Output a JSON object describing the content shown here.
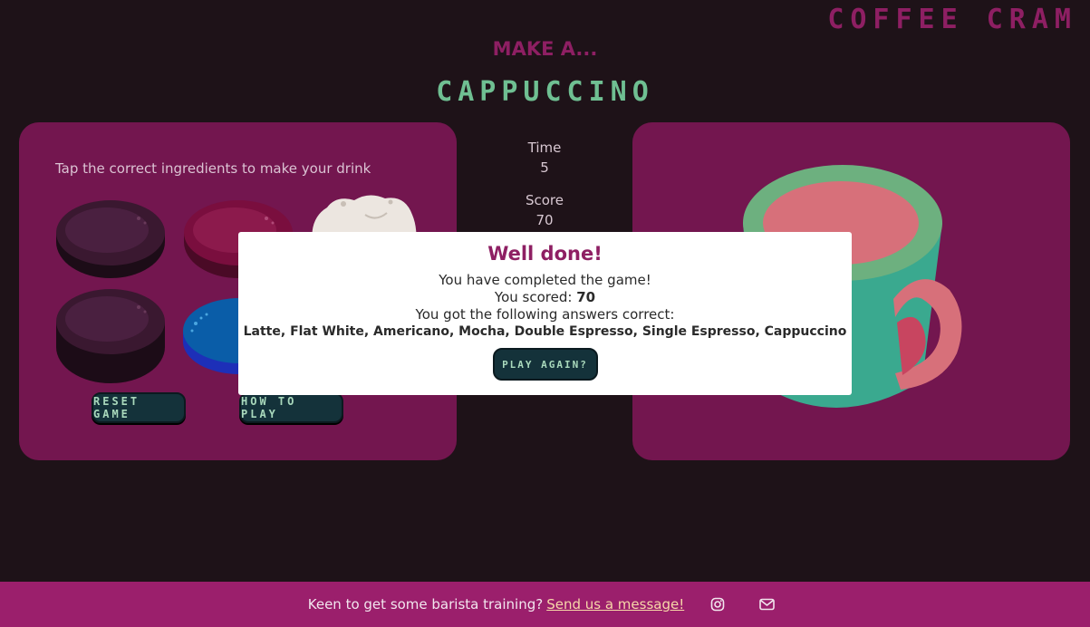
{
  "header": {
    "brand": "COFFEE CRAM",
    "prompt": "MAKE A...",
    "drink": "CAPPUCCINO"
  },
  "left_panel": {
    "instruction": "Tap the correct ingredients to make your drink",
    "reset_label": "RESET GAME",
    "how_label": "HOW TO PLAY"
  },
  "stats": {
    "time_label": "Time",
    "time_value": "5",
    "score_label": "Score",
    "score_value": "70"
  },
  "modal": {
    "title": "Well done!",
    "line1": "You have completed the game!",
    "score_prefix": "You scored: ",
    "score_value": "70",
    "line3": "You got the following answers correct:",
    "answers": "Latte, Flat White, Americano, Mocha, Double Espresso, Single Espresso, Cappuccino",
    "button": "PLAY AGAIN?"
  },
  "footer": {
    "text": "Keen to get some barista training?",
    "link": "Send us a message!",
    "icons": [
      "instagram-icon",
      "mail-icon"
    ]
  },
  "colors": {
    "background": "#1e1218",
    "panel": "#73164f",
    "accent": "#8e1f63",
    "drink_title": "#6fbf92",
    "button": "#14323a",
    "footer": "#9b1f6c"
  }
}
